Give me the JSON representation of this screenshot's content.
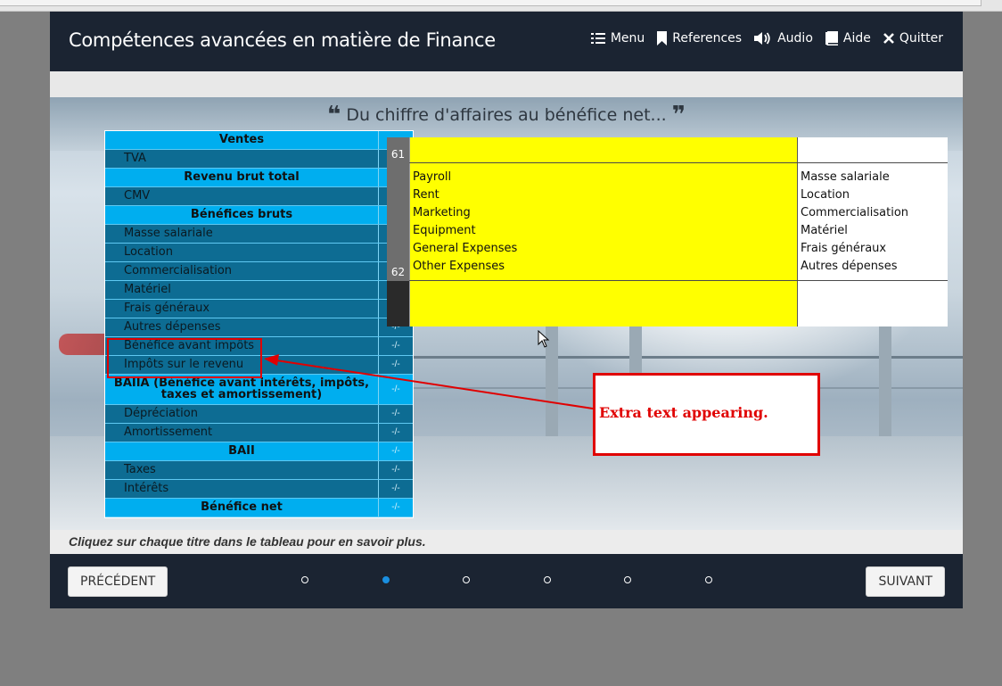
{
  "header": {
    "title": "Compétences avancées en matière de Finance",
    "nav": [
      {
        "label": "Menu",
        "icon": "list-icon"
      },
      {
        "label": "References",
        "icon": "bookmark-icon"
      },
      {
        "label": "Audio",
        "icon": "speaker-icon"
      },
      {
        "label": "Aide",
        "icon": "book-icon"
      },
      {
        "label": "Quitter",
        "icon": "close-icon"
      }
    ]
  },
  "slide": {
    "quote": "Du chiffre d'affaires au bénéfice net...",
    "quote_open": "❝",
    "quote_close": "❞"
  },
  "pnl": {
    "rows": [
      {
        "label": "Ventes",
        "kind": "head",
        "value": ""
      },
      {
        "label": "TVA",
        "kind": "sub",
        "value": ""
      },
      {
        "label": "Revenu brut total",
        "kind": "head",
        "value": ""
      },
      {
        "label": "CMV",
        "kind": "sub",
        "value": ""
      },
      {
        "label": "Bénéfices bruts",
        "kind": "head",
        "value": ""
      },
      {
        "label": "Masse salariale",
        "kind": "sub",
        "value": ""
      },
      {
        "label": "Location",
        "kind": "sub",
        "value": ""
      },
      {
        "label": "Commercialisation",
        "kind": "sub",
        "value": ""
      },
      {
        "label": "Matériel",
        "kind": "sub",
        "value": ""
      },
      {
        "label": "Frais généraux",
        "kind": "sub",
        "value": ""
      },
      {
        "label": "Autres dépenses",
        "kind": "sub",
        "value": "-/-"
      },
      {
        "label": "Bénéfice avant impôts",
        "kind": "sub",
        "value": "-/-"
      },
      {
        "label": "Impôts sur le revenu",
        "kind": "sub",
        "value": "-/-"
      },
      {
        "label": "BAIIA (Bénéfice avant intérêts, impôts, taxes et amortissement)",
        "kind": "head",
        "value": "-/-"
      },
      {
        "label": "Dépréciation",
        "kind": "sub",
        "value": "-/-"
      },
      {
        "label": "Amortissement",
        "kind": "sub",
        "value": "-/-"
      },
      {
        "label": "BAII",
        "kind": "head",
        "value": "-/-"
      },
      {
        "label": "Taxes",
        "kind": "sub",
        "value": "-/-"
      },
      {
        "label": "Intérêts",
        "kind": "sub",
        "value": "-/-"
      },
      {
        "label": "Bénéfice net",
        "kind": "head",
        "value": "-/-"
      }
    ]
  },
  "sheet": {
    "row_numbers": [
      "61",
      "62"
    ],
    "english": [
      "Payroll",
      "Rent",
      "Marketing",
      "Equipment",
      "General Expenses",
      "Other Expenses"
    ],
    "french": [
      "Masse salariale",
      "Location",
      "Commercialisation",
      "Matériel",
      "Frais généraux",
      "Autres dépenses"
    ]
  },
  "annotation": {
    "text": "Extra text appearing.",
    "color": "#e00000"
  },
  "caption": "Cliquez sur chaque titre dans le tableau pour en savoir plus.",
  "footer": {
    "prev_label": "PRÉCÉDENT",
    "next_label": "SUIVANT",
    "page_count": 6,
    "active_page": 2
  },
  "colors": {
    "header_bg": "#1b2432",
    "table_head": "#00aeef",
    "table_sub": "#0d6c93",
    "highlight_yellow": "#ffff00",
    "active_dot": "#1a8fe0"
  }
}
